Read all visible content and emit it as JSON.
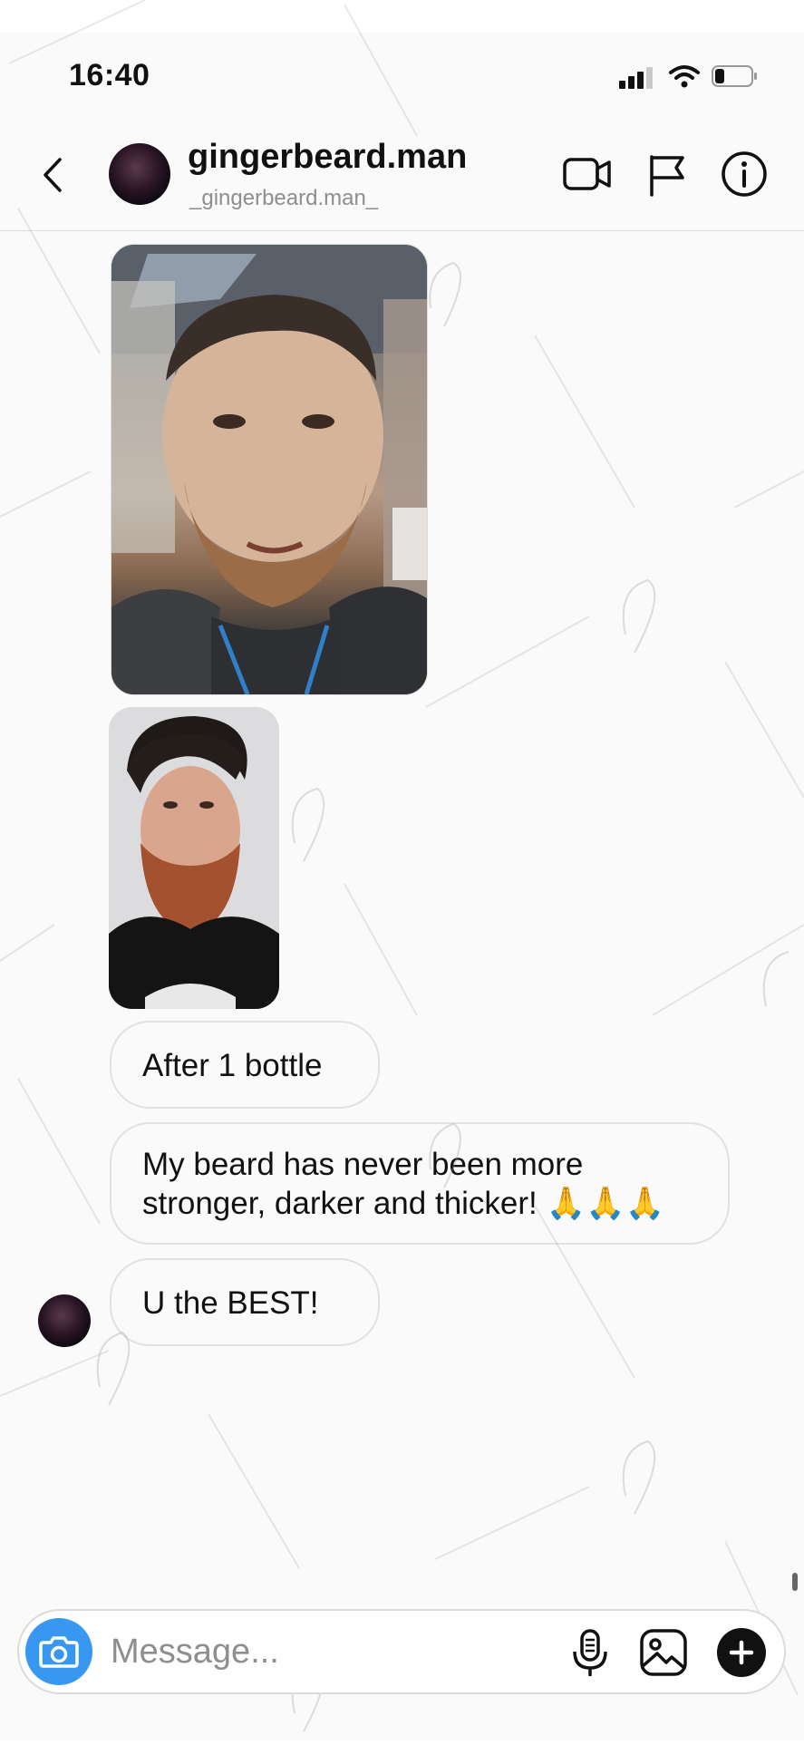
{
  "status_bar": {
    "time": "16:40"
  },
  "header": {
    "username": "gingerbeard.man",
    "handle": "_gingerbeard.man_"
  },
  "messages": [
    {
      "type": "photo",
      "description_name": "selfie-photo-1"
    },
    {
      "type": "photo",
      "description_name": "selfie-photo-2"
    },
    {
      "type": "text",
      "text": "After 1 bottle"
    },
    {
      "type": "text",
      "text": "My beard has never been more stronger, darker and thicker! 🙏🙏🙏"
    },
    {
      "type": "text",
      "text": "U  the BEST!"
    }
  ],
  "composer": {
    "placeholder": "Message..."
  },
  "icons": {
    "back": "chevron-left-icon",
    "video": "video-camera-icon",
    "flag": "flag-icon",
    "info": "info-icon",
    "camera": "camera-icon",
    "mic": "microphone-icon",
    "gallery": "image-gallery-icon",
    "plus": "plus-icon"
  },
  "colors": {
    "accent": "#3897f0",
    "bubble_border": "#e1e1e1",
    "secondary_text": "#8e8e8e"
  }
}
